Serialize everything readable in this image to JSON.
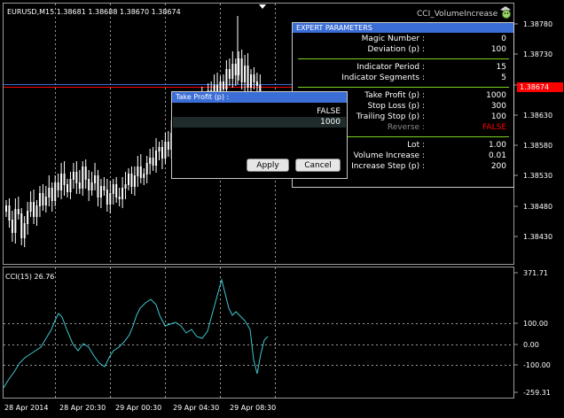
{
  "colors": {
    "background": "#000000",
    "grid": "#9b9b9b",
    "candles": "#ffffff",
    "cci_line": "#3fc7d0",
    "bid_line": "#3b6dd6",
    "ask_line": "#ff0000",
    "panel_header": "#3b6dd6",
    "separator": "#7ed321",
    "false_value": "#ff0000",
    "disabled_text": "#8a8a8a"
  },
  "main_chart": {
    "title": "EURUSD,M15  1.38681 1.38688 1.38670 1.38674",
    "expert_name": "CCI_VolumeIncrease",
    "expert_icon": "smiley-hat-icon",
    "price_axis": [
      "1.38780",
      "1.38730",
      "1.38680",
      "1.38630",
      "1.38580",
      "1.38530",
      "1.38480",
      "1.38430"
    ],
    "current_price": "1.38674"
  },
  "sub_chart": {
    "title": "CCI(15) 26.76",
    "levels": [
      "371.71",
      "100.00",
      "0.00",
      "-100.00",
      "-259.31"
    ]
  },
  "time_axis": [
    "28 Apr 2014",
    "28 Apr 20:30",
    "29 Apr 00:30",
    "29 Apr 04:30",
    "29 Apr 08:30"
  ],
  "expert_params": {
    "title": "EXPERT  PARAMETERS",
    "groups": [
      [
        {
          "label": "Magic Number :",
          "value": "0"
        },
        {
          "label": "Deviation (p) :",
          "value": "100"
        }
      ],
      [
        {
          "label": "Indicator Period :",
          "value": "15"
        },
        {
          "label": "Indicator Segments :",
          "value": "5"
        }
      ],
      [
        {
          "label": "Take Profit (p) :",
          "value": "1000"
        },
        {
          "label": "Stop Loss (p) :",
          "value": "300"
        },
        {
          "label": "Trailing Stop (p) :",
          "value": "100"
        },
        {
          "label": "Reverse :",
          "value": "FALSE"
        }
      ],
      [
        {
          "label": "Lot :",
          "value": "1.00"
        },
        {
          "label": "Volume Increase :",
          "value": "0.01"
        },
        {
          "label": "Increase Step (p) :",
          "value": "200"
        }
      ]
    ]
  },
  "take_profit_dialog": {
    "title": "Take Profit (p) :",
    "options": [
      "FALSE",
      "1000"
    ],
    "apply_label": "Apply",
    "cancel_label": "Cancel"
  }
}
